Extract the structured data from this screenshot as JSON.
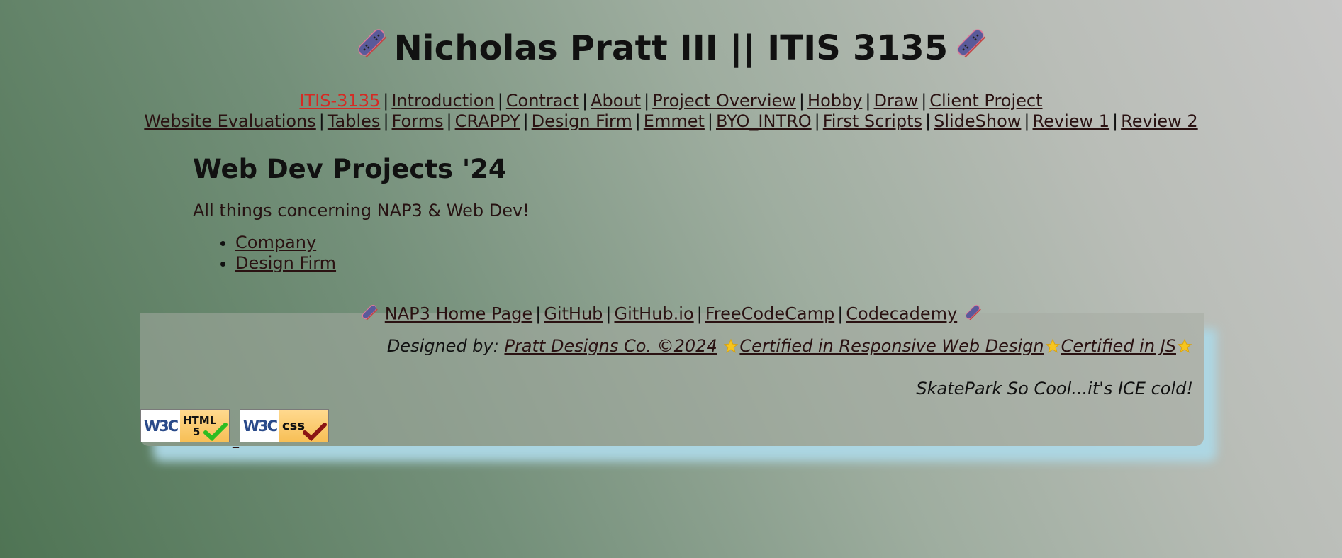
{
  "header": {
    "title": "Nicholas Pratt III || ITIS 3135",
    "left_icon": "skateboard-icon",
    "right_icon": "skateboard-icon"
  },
  "nav": {
    "row1": [
      "ITIS-3135",
      "Introduction",
      "Contract",
      "About",
      "Project Overview",
      "Hobby",
      "Draw",
      "Client Project"
    ],
    "row2": [
      "Website Evaluations",
      "Tables",
      "Forms",
      "CRAPPY",
      "Design Firm",
      "Emmet",
      "BYO_INTRO",
      "First Scripts",
      "SlideShow",
      "Review 1",
      "Review 2"
    ],
    "separator": "|"
  },
  "main": {
    "heading": "Web Dev Projects '24",
    "description": "All things concerning NAP3 & Web Dev!",
    "links": [
      "Company",
      "Design Firm"
    ]
  },
  "footer": {
    "links": [
      "NAP3 Home Page",
      "GitHub",
      "GitHub.io",
      "FreeCodeCamp",
      "Codecademy"
    ],
    "designed_by_prefix": "Designed by:",
    "designer_link": "Pratt Designs Co. ©2024",
    "cert1": "Certified in Responsive Web Design",
    "cert2": "Certified in JS",
    "tagline": "SkatePark So Cool...it's ICE cold!",
    "star_icon": "star-icon"
  },
  "badges": {
    "html": {
      "w3c": "W3C",
      "line1": "HTML",
      "line2": "5"
    },
    "css": {
      "w3c": "W3C",
      "line1": "css"
    },
    "underscore": "_"
  },
  "colors": {
    "current_link": "#d62a23",
    "panel_shadow": "#add8e6",
    "skateboard_deck": "#5a5a9a",
    "star": "#f7c51e"
  }
}
